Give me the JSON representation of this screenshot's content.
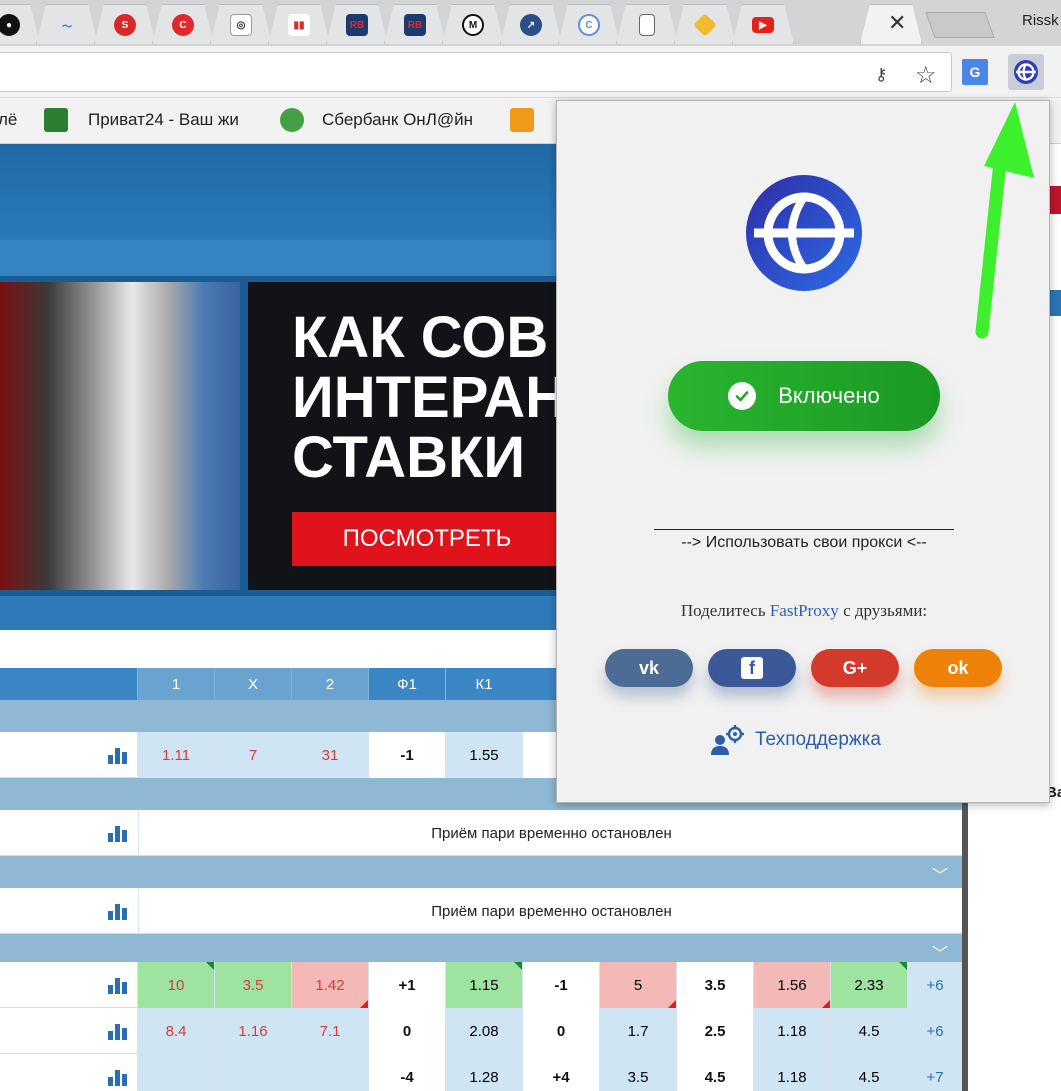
{
  "browser": {
    "tabs": [
      {
        "icon": "saturn-icon",
        "color": "#111111"
      },
      {
        "icon": "chart-line-icon",
        "color": "#e3e4e6"
      },
      {
        "icon": "s-circle-icon",
        "color": "#d7282b"
      },
      {
        "icon": "c-circle-icon",
        "color": "#e1282b"
      },
      {
        "icon": "eye-icon",
        "color": "#ffffff"
      },
      {
        "icon": "bar-chart-icon",
        "color": "#ffffff"
      },
      {
        "icon": "rb-icon",
        "color": "#1b3a6e",
        "text": "RB"
      },
      {
        "icon": "rb-icon",
        "color": "#1b3a6e",
        "text": "RB"
      },
      {
        "icon": "coinmarketcap-icon",
        "color": "#ffffff"
      },
      {
        "icon": "globe-chart-icon",
        "color": "#2a4e86"
      },
      {
        "icon": "swirl-icon",
        "color": "#ffffff"
      },
      {
        "icon": "document-icon",
        "color": "#ffffff"
      },
      {
        "icon": "binance-icon",
        "color": "#f3ba2f"
      },
      {
        "icon": "youtube-icon",
        "color": "#e62117"
      }
    ],
    "user": "Rissk",
    "bookmarks": [
      {
        "label": "лё",
        "icon": "none"
      },
      {
        "label": "Приват24 - Ваш жи",
        "icon": "privat-icon"
      },
      {
        "label": "Сбербанк ОнЛ@йн",
        "icon": "sberbank-icon"
      },
      {
        "label": "",
        "icon": "ok-icon"
      }
    ]
  },
  "banner": {
    "title": "КАК СОВ\nИНТЕРАН\nСТАВКИ",
    "cta": "ПОСМОТРЕТЬ"
  },
  "odds": {
    "headers": [
      "1",
      "X",
      "2",
      "Ф1",
      "К1"
    ],
    "row1": [
      "1.11",
      "7",
      "31",
      "-1",
      "1.55",
      "-"
    ],
    "suspended": "Приём пари временно остановлен",
    "row4": [
      "10",
      "3.5",
      "1.42",
      "+1",
      "1.15",
      "-1",
      "5",
      "3.5",
      "1.56",
      "2.33",
      "+6"
    ],
    "row5": [
      "8.4",
      "1.16",
      "7.1",
      "0",
      "2.08",
      "0",
      "1.7",
      "2.5",
      "1.18",
      "4.5",
      "+6"
    ],
    "row6": [
      "",
      "",
      "",
      "-4",
      "1.28",
      "+4",
      "3.5",
      "4.5",
      "1.18",
      "4.5",
      "+7"
    ]
  },
  "right_edge": {
    "text": "Ba"
  },
  "popup": {
    "status": "Включено",
    "own_proxy": "--> Использовать свои прокси <--",
    "share_prefix": "Поделитесь ",
    "share_brand": "FastProxy",
    "share_suffix": " с друзьями:",
    "social": [
      {
        "name": "vk",
        "label": "vk"
      },
      {
        "name": "facebook",
        "label": "f"
      },
      {
        "name": "google-plus",
        "label": "G+"
      },
      {
        "name": "odnoklassniki",
        "label": "ok"
      }
    ],
    "support": "Техподдержка"
  },
  "colors": {
    "accent_green": "#1fa62a",
    "brand_blue": "#2f5fb5",
    "arrow": "#3cf02c"
  }
}
